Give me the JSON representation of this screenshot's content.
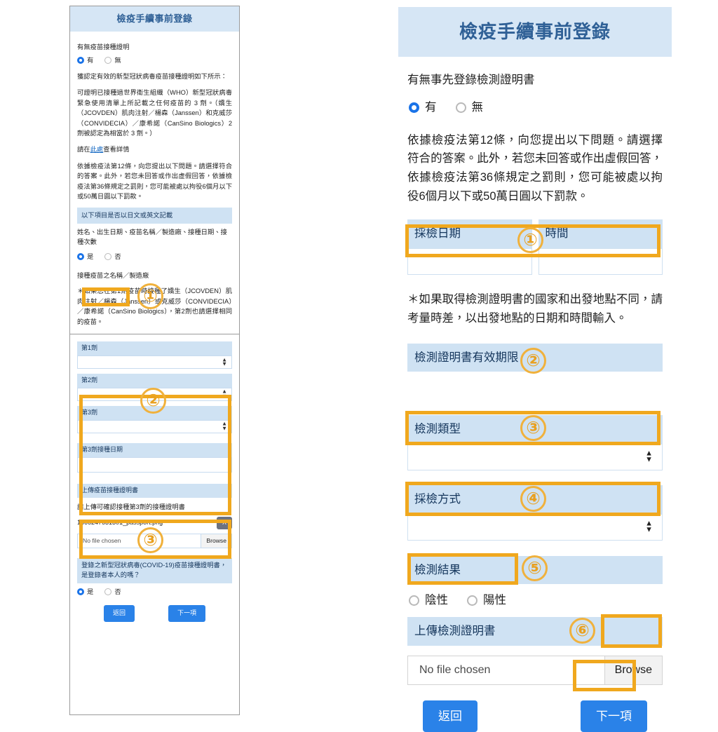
{
  "left": {
    "header": "檢疫手續事前登錄",
    "q1_label": "有無疫苗接種證明",
    "q1_yes": "有",
    "q1_no": "無",
    "para1": "獲認定有效的新型冠狀病毒疫苗接種證明如下所示：",
    "para2": "可證明已接種過世界衛生組織（WHO）新型冠狀病毒緊急使用清單上所記載之任何疫苗的 3 劑。（嬌生（JCOVDEN）肌肉注射／楊森（Janssen）和克威莎（CONVIDECIA）／康希諾（CanSino Biologics）2 劑被認定為相當於 3 劑。）",
    "link_prefix": "請在",
    "link_text": "此處",
    "link_suffix": "查看詳情",
    "para3": "依據檢疫法第12條，向您提出以下問題。請選擇符合的答案。此外，若您未回答或作出虛假回答，依據檢疫法第36條規定之罰則，您可能被處以拘役6個月以下或50萬日圓以下罰款。",
    "band1": "以下項目是否以日文或英文記載",
    "fields_label": "姓名、出生日期、疫苗名稱／製造廠、接種日期、接種次數",
    "yes": "是",
    "no": "否",
    "vaccine_name_label": "接種疫苗之名稱／製造廠",
    "note1": "＊如果您在第1劑疫苗時接種了嬌生（JCOVDEN）肌肉注射／楊森（Janssen）或克威莎（CONVIDECIA）／康希諾（CanSino Biologics），第2劑也請選擇相同的疫苗。",
    "dose1": "第1劑",
    "dose2": "第2劑",
    "dose3": "第3劑",
    "dose3_date": "第3劑接種日期",
    "upload_band": "上傳疫苗接種證明書",
    "upload_hint": "請上傳可確認接種第3劑的接種證明書",
    "uploaded_file": "1666247631301_passport.png",
    "remove_label": "X",
    "file_placeholder": "No file chosen",
    "browse_label": "Browse",
    "owner_band": "登錄之新型冠狀病毒(COVID-19)疫苗接種證明書，是登錄者本人的嗎？",
    "back_button": "返回",
    "next_button": "下一項"
  },
  "right": {
    "header": "檢疫手續事前登錄",
    "q1_label": "有無事先登錄檢測證明書",
    "q1_yes": "有",
    "q1_no": "無",
    "para1": "依據檢疫法第12條，向您提出以下問題。請選擇符合的答案。此外，若您未回答或作出虛假回答，依據檢疫法第36條規定之罰則，您可能被處以拘役6個月以下或50萬日圓以下罰款。",
    "sample_date_label": "採檢日期",
    "time_label": "時間",
    "note1": "＊如果取得檢測證明書的國家和出發地點不同，請考量時差，以出發地點的日期和時間輸入。",
    "validity_label": "檢測證明書有效期限",
    "test_type_label": "檢測類型",
    "sample_method_label": "採檢方式",
    "result_label": "檢測結果",
    "result_negative": "陰性",
    "result_positive": "陽性",
    "upload_band": "上傳檢測證明書",
    "file_placeholder": "No file chosen",
    "browse_label": "Browse",
    "back_button": "返回",
    "next_button": "下一項"
  },
  "markers": {
    "m1": "①",
    "m2": "②",
    "m3": "③",
    "m4": "④",
    "m5": "⑤",
    "m6": "⑥"
  },
  "colors": {
    "accent_blue": "#2a82e8",
    "band_blue": "#cfe2f3",
    "header_blue": "#d6e6f5",
    "header_text": "#2f6096",
    "highlight_orange": "#f0a81e",
    "marker_orange": "#e8a020",
    "radio_blue": "#1a73e8"
  }
}
